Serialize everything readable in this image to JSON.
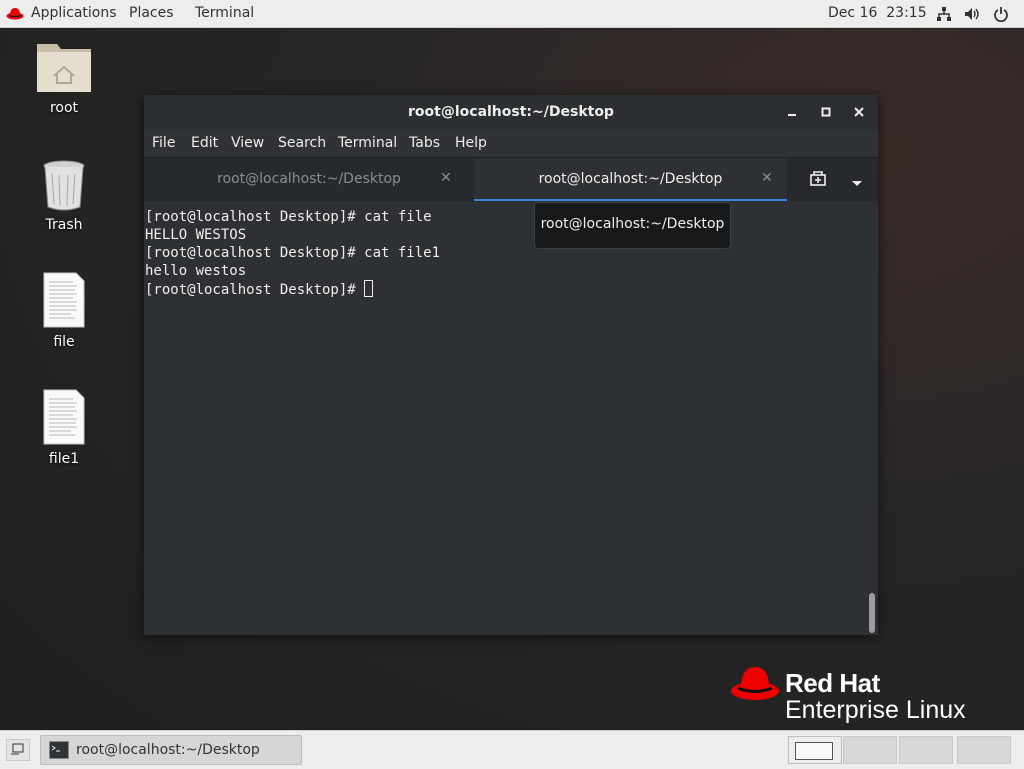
{
  "topbar": {
    "applications": "Applications",
    "places": "Places",
    "terminal": "Terminal",
    "clock": "Dec 16  23:15",
    "icons": [
      "network-icon",
      "volume-icon",
      "power-icon"
    ]
  },
  "desktop": {
    "icons": [
      {
        "label": "root",
        "icon": "home-folder-icon"
      },
      {
        "label": "Trash",
        "icon": "trash-icon"
      },
      {
        "label": "file",
        "icon": "text-file-icon"
      },
      {
        "label": "file1",
        "icon": "text-file-icon"
      }
    ]
  },
  "window": {
    "title": "root@localhost:~/Desktop",
    "menu": [
      "File",
      "Edit",
      "View",
      "Search",
      "Terminal",
      "Tabs",
      "Help"
    ],
    "tabs": [
      {
        "label": "root@localhost:~/Desktop",
        "active": false
      },
      {
        "label": "root@localhost:~/Desktop",
        "active": true
      }
    ],
    "tooltip": "root@localhost:~/Desktop",
    "lines": [
      "[root@localhost Desktop]# cat file",
      "HELLO WESTOS",
      "[root@localhost Desktop]# cat file1",
      "hello westos",
      "[root@localhost Desktop]# "
    ]
  },
  "brand": {
    "line1": "Red Hat",
    "line2": "Enterprise Linux",
    "color": "#ee0000"
  },
  "taskbar": {
    "task_label": "root@localhost:~/Desktop",
    "workspaces": 4,
    "active_workspace": 1
  }
}
